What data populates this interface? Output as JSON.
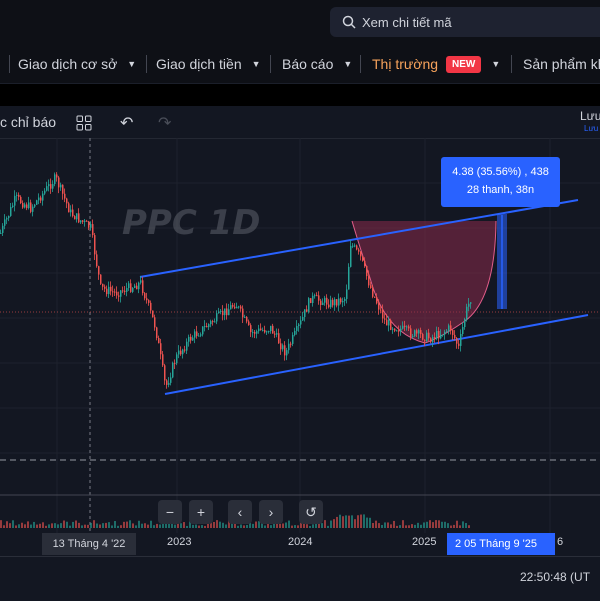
{
  "search": {
    "placeholder": "Xem chi tiết mã"
  },
  "nav": {
    "items": [
      {
        "label": "Giao dịch cơ sở",
        "caret": "▼"
      },
      {
        "label": "Giao dịch tiền",
        "caret": "▼"
      },
      {
        "label": "Báo cáo",
        "caret": "▼"
      },
      {
        "label": "Thị trường",
        "caret": "▼",
        "badge": "NEW",
        "color": "#f7a35c"
      },
      {
        "label": "Sản phẩm kh"
      }
    ]
  },
  "toolbar": {
    "indicators_label": "c chỉ báo",
    "right_label": "Lưu",
    "right_sub": "Lưu"
  },
  "chart": {
    "watermark": "PPC 1D",
    "measure": {
      "line1": "4.38 (35.56%) , 438",
      "line2": "28 thanh, 38n"
    },
    "colors": {
      "up": "#26a69a",
      "down": "#ef5350",
      "channel": "#2962ff",
      "arc_fill": "#8b2a4a"
    }
  },
  "time_axis": {
    "ticks": [
      "2023",
      "2024",
      "2025",
      "6"
    ],
    "crosshair_date": "13 Tháng 4 '22",
    "selected_date": "2  05 Tháng 9 '25"
  },
  "zoom_controls": {
    "minus": "−",
    "plus": "+",
    "left": "‹",
    "right": "›",
    "reset": "↺"
  },
  "footer": {
    "clock": "22:50:48 (UT"
  }
}
